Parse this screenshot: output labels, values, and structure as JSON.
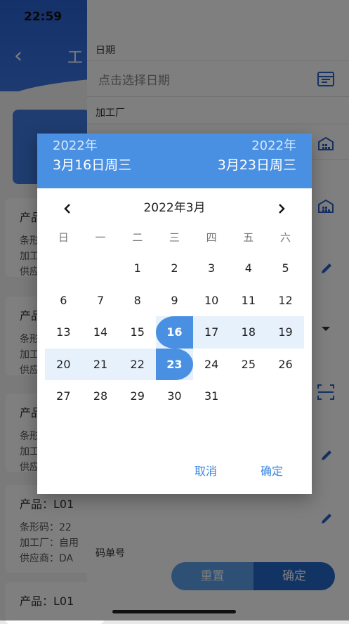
{
  "status_bar": {
    "time": "22:59"
  },
  "background": {
    "title_partial": "工",
    "cards": [
      {
        "product": "产品",
        "barcode": "条形",
        "factory": "加工",
        "supplier": "供应"
      },
      {
        "product": "产品",
        "barcode": "条形",
        "factory": "加工",
        "supplier": "供应"
      },
      {
        "product": "产品",
        "barcode": "条形",
        "factory": "加工",
        "supplier": "供应"
      },
      {
        "product": "产品：L01",
        "barcode": "条形码：22",
        "factory": "加工厂：自用",
        "supplier": "供应商：DA"
      },
      {
        "product": "产品：L01"
      }
    ],
    "form": {
      "date_label": "日期",
      "date_placeholder": "点击选择日期",
      "factory_label": "加工厂",
      "code_label": "码单号",
      "reset_label": "重置",
      "confirm_label": "确定"
    }
  },
  "dialog": {
    "start_year": "2022年",
    "start_date": "3月16日周三",
    "end_year": "2022年",
    "end_date": "3月23日周三",
    "month_title": "2022年3月",
    "weekdays": [
      "日",
      "一",
      "二",
      "三",
      "四",
      "五",
      "六"
    ],
    "first_weekday_index": 2,
    "days_in_month": 31,
    "range_start": 16,
    "range_end": 23,
    "cancel_label": "取消",
    "ok_label": "确定",
    "accent_color": "#4a90e2",
    "range_color": "#e7f1fc"
  }
}
